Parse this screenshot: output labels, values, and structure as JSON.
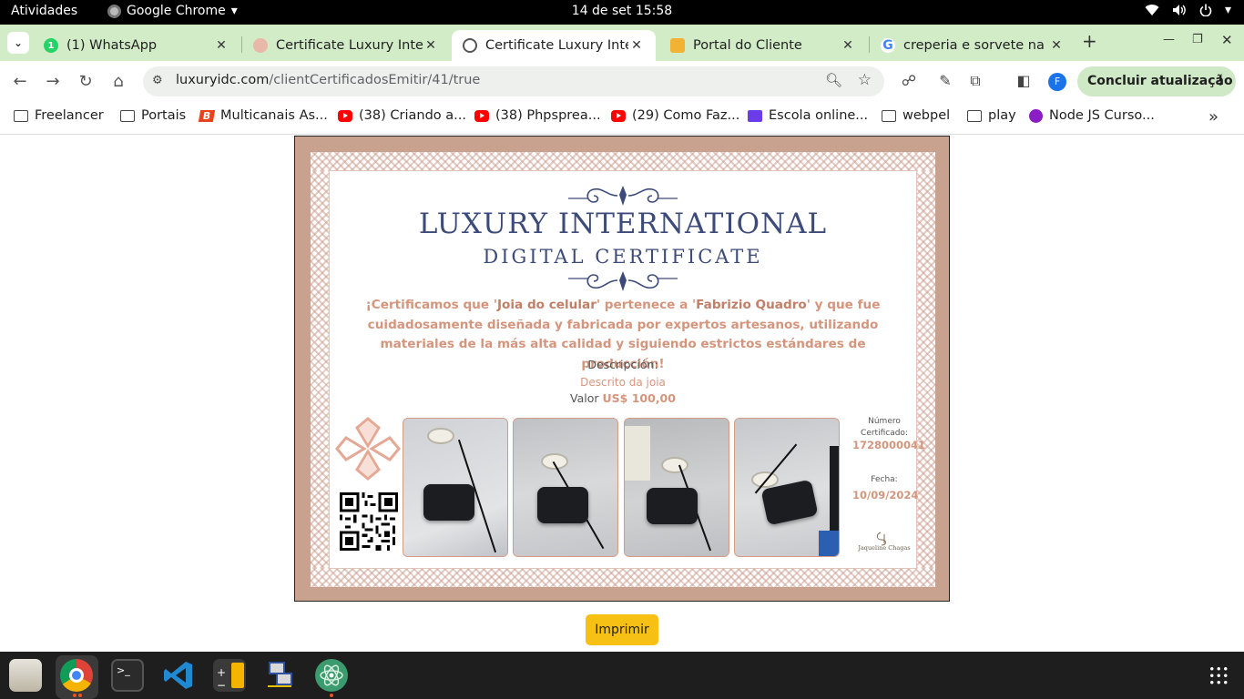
{
  "topbar": {
    "activities": "Atividades",
    "app_name": "Google Chrome",
    "clock": "14 de set  15:58"
  },
  "tabs": [
    {
      "title": "(1) WhatsApp",
      "favicon": "whatsapp-icon",
      "active": false
    },
    {
      "title": "Certificate Luxury Inte",
      "favicon": "luxury-icon",
      "active": false
    },
    {
      "title": "Certificate Luxury Inte",
      "favicon": "globe-icon",
      "active": true
    },
    {
      "title": "Portal do Cliente",
      "favicon": "portal-icon",
      "active": false
    },
    {
      "title": "creperia e sorvete na c",
      "favicon": "google-icon",
      "active": false
    }
  ],
  "omnibox": {
    "host": "luxuryidc.com",
    "path": "/clientCertificadosEmitir/41/true"
  },
  "profile_initial": "F",
  "update_button": "Concluir atualização",
  "bookmarks": [
    {
      "label": "Freelancer",
      "icon": "folder-icon"
    },
    {
      "label": "Portais",
      "icon": "folder-icon"
    },
    {
      "label": "Multicanais As...",
      "icon": "bling-icon"
    },
    {
      "label": "(38) Criando a...",
      "icon": "youtube-icon"
    },
    {
      "label": "(38) Phpsprea...",
      "icon": "youtube-icon"
    },
    {
      "label": "(29) Como Faz...",
      "icon": "youtube-icon"
    },
    {
      "label": "Escola online...",
      "icon": "school-icon"
    },
    {
      "label": "webpel",
      "icon": "folder-icon"
    },
    {
      "label": "play",
      "icon": "folder-icon"
    },
    {
      "label": "Node JS Curso...",
      "icon": "node-icon"
    }
  ],
  "certificate": {
    "title_line1": "LUXURY INTERNATIONAL",
    "title_line2": "DIGITAL CERTIFICATE",
    "text_before_product": "¡Certificamos que '",
    "product": "Joia do celular",
    "text_middle": "' pertenece a '",
    "owner": "Fabrizio Quadro",
    "text_after": "' y que fue cuidadosamente diseñada y fabricada por expertos artesanos, utilizando materiales de la más alta calidad y siguiendo estrictos estándares de producción!",
    "description_label": "Descripción:",
    "description_value": "Descrito da joia",
    "value_label": "Valor",
    "value_amount": "US$ 100,00",
    "number_label": "Número Certificado:",
    "number_value": "1728000041",
    "date_label": "Fecha:",
    "date_value": "10/09/2024",
    "signature_name": "Jaqueline Chagas"
  },
  "print_button": "Imprimir",
  "colors": {
    "accent": "#d4957d",
    "frame": "#c9a18f",
    "title": "#3d4b7a",
    "print_button": "#f7c014"
  }
}
